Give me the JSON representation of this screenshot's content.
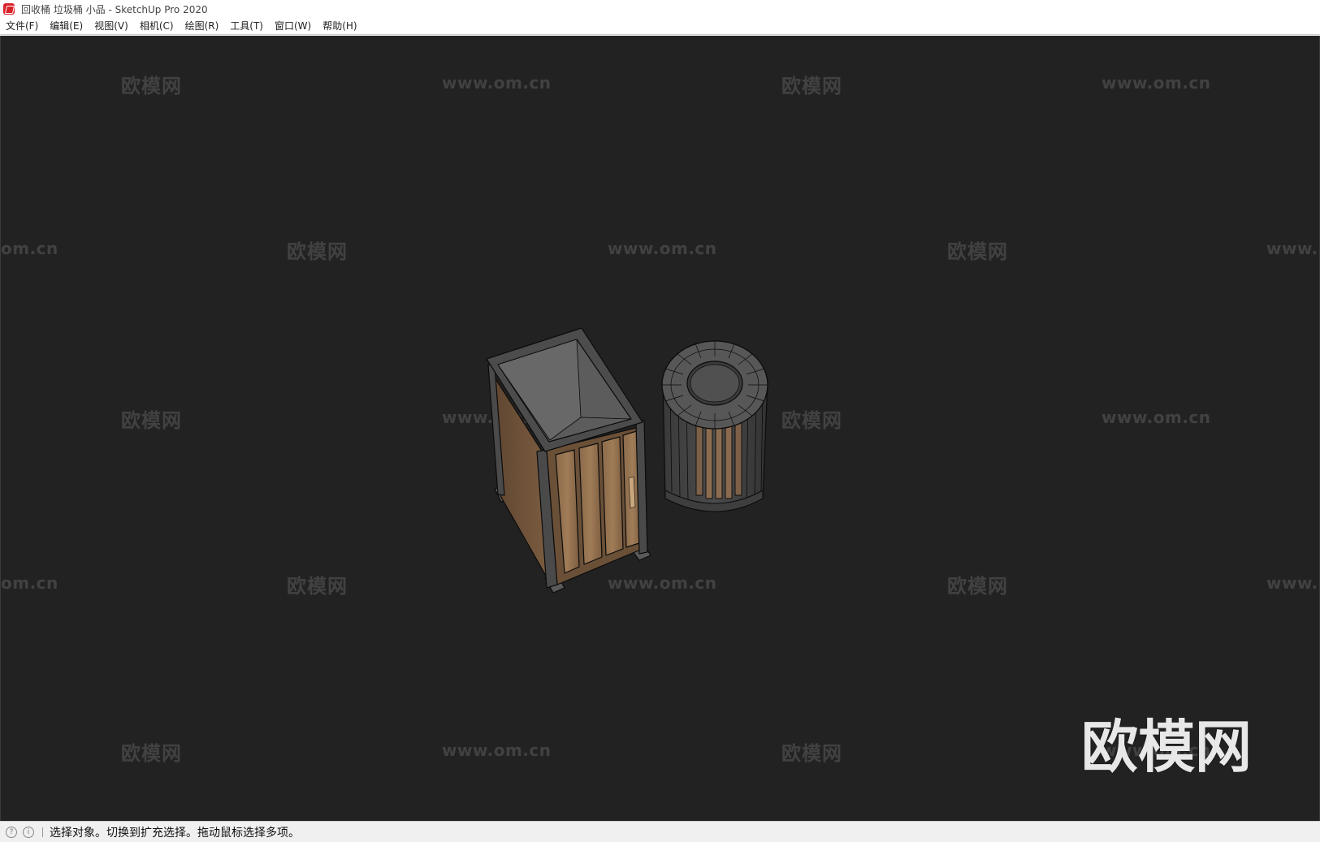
{
  "window": {
    "title": "回收桶 垃圾桶 小品 - SketchUp Pro 2020"
  },
  "menu": [
    {
      "label": "文件(F)",
      "key": "file"
    },
    {
      "label": "编辑(E)",
      "key": "edit"
    },
    {
      "label": "视图(V)",
      "key": "view"
    },
    {
      "label": "相机(C)",
      "key": "camera"
    },
    {
      "label": "绘图(R)",
      "key": "draw"
    },
    {
      "label": "工具(T)",
      "key": "tools"
    },
    {
      "label": "窗口(W)",
      "key": "window"
    },
    {
      "label": "帮助(H)",
      "key": "help"
    }
  ],
  "watermark": {
    "brand": "欧模网",
    "url": "www.om.cn",
    "url_partial_left": "om.cn",
    "url_partial_right": "www."
  },
  "statusbar": {
    "icons": [
      "geo-location-icon",
      "credits-icon"
    ],
    "message": "选择对象。切换到扩充选择。拖动鼠标选择多项。"
  },
  "colors": {
    "viewport_bg": "#222222",
    "wood": "#7a5a3c",
    "frame": "#4a4a4a",
    "edge": "#0a0a0a"
  },
  "icons": {
    "app": "sketchup-logo-icon"
  }
}
